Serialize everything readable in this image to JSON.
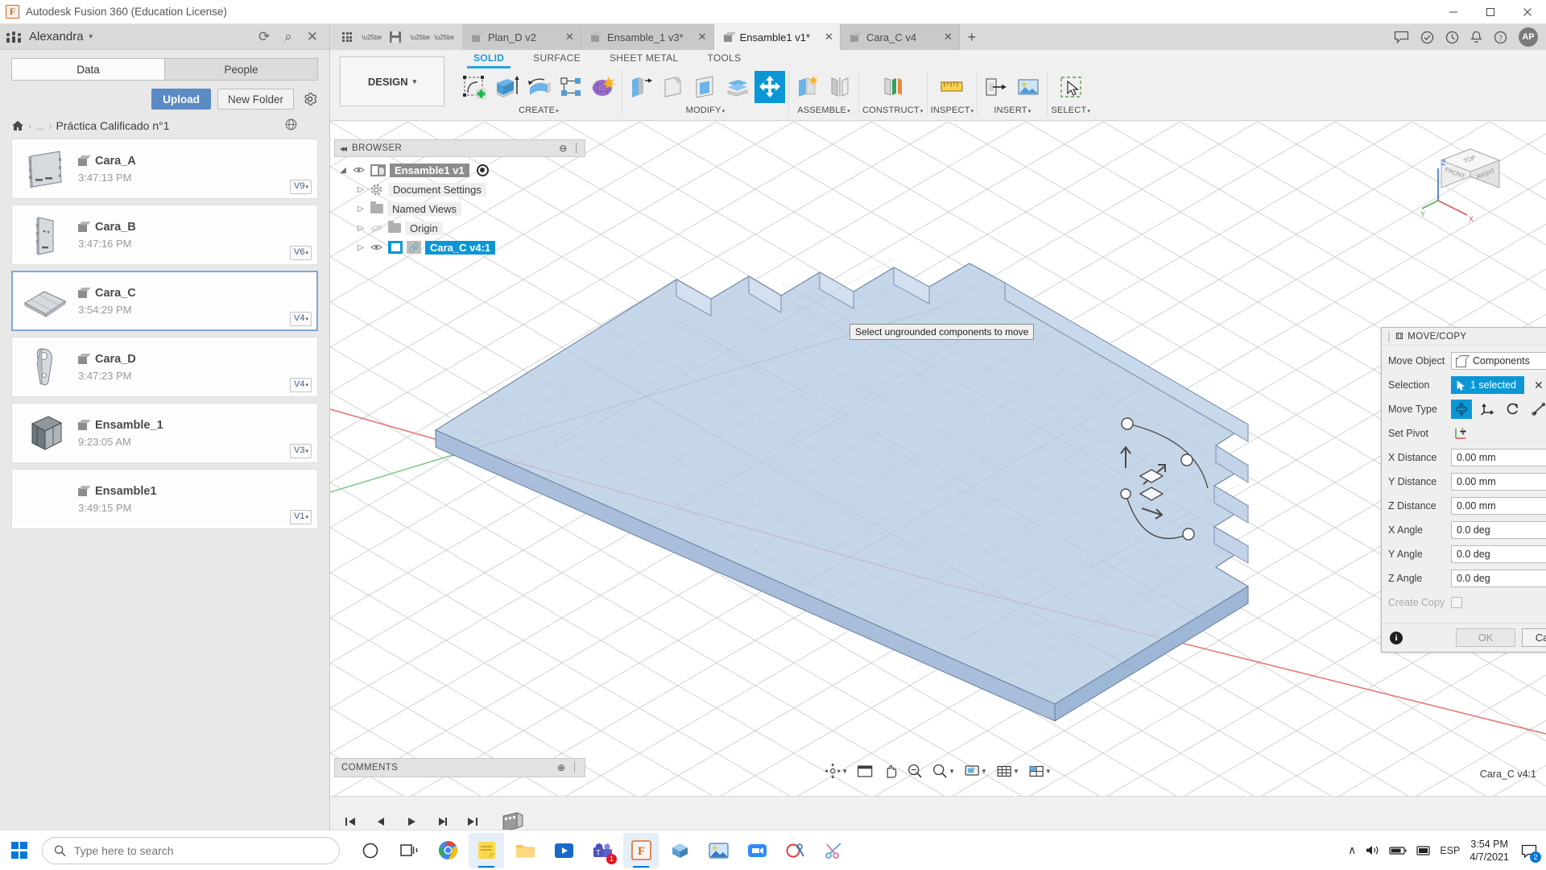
{
  "window": {
    "title": "Autodesk Fusion 360 (Education License)",
    "minimize": "—",
    "maximize": "☐",
    "close": "✕"
  },
  "data_panel": {
    "user": "Alexandra",
    "user_caret": "▾",
    "icons": {
      "refresh": "⟳",
      "search": "⌕",
      "close": "✕"
    },
    "tabs": [
      {
        "label": "Data",
        "active": true
      },
      {
        "label": "People",
        "active": false
      }
    ],
    "upload_label": "Upload",
    "new_folder_label": "New Folder",
    "breadcrumb": {
      "home": "⌂",
      "sep": "›",
      "dots": "...",
      "folder": "Práctica Calificado n°1"
    },
    "items": [
      {
        "name": "Cara_A",
        "time": "3:47:13 PM",
        "version": "V9",
        "selected": false
      },
      {
        "name": "Cara_B",
        "time": "3:47:16 PM",
        "version": "V6",
        "selected": false
      },
      {
        "name": "Cara_C",
        "time": "3:54:29 PM",
        "version": "V4",
        "selected": true
      },
      {
        "name": "Cara_D",
        "time": "3:47:23 PM",
        "version": "V4",
        "selected": false
      },
      {
        "name": "Ensamble_1",
        "time": "9:23:05 AM",
        "version": "V3",
        "selected": false
      },
      {
        "name": "Ensamble1",
        "time": "3:49:15 PM",
        "version": "V1",
        "selected": false
      }
    ],
    "version_caret": "▾"
  },
  "fusion": {
    "quick_access": [
      "grid-icon",
      "new-document-icon",
      "save-icon",
      "undo-icon",
      "redo-icon"
    ],
    "document_tabs": [
      {
        "label": "Plan_D v2",
        "active": false
      },
      {
        "label": "Ensamble_1 v3*",
        "active": false
      },
      {
        "label": "Ensamble1 v1*",
        "active": true
      },
      {
        "label": "Cara_C v4",
        "active": false
      }
    ],
    "new_tab": "+",
    "tab_close": "✕",
    "avatar_initials": "AP",
    "workspace": "DESIGN",
    "workspace_caret": "▾",
    "ribbon_tabs": [
      {
        "label": "SOLID",
        "active": true
      },
      {
        "label": "SURFACE",
        "active": false
      },
      {
        "label": "SHEET METAL",
        "active": false
      },
      {
        "label": "TOOLS",
        "active": false
      }
    ],
    "ribbon_groups": [
      {
        "label": "CREATE",
        "caret": "▾",
        "buttons": [
          "create-sketch-icon",
          "extrude-icon",
          "revolve-icon",
          "pattern-icon",
          "form-icon"
        ]
      },
      {
        "label": "MODIFY",
        "caret": "▾",
        "buttons": [
          "press-pull-icon",
          "fillet-icon",
          "shell-icon",
          "offset-face-icon",
          "move-copy-icon"
        ]
      },
      {
        "label": "ASSEMBLE",
        "caret": "▾",
        "buttons": [
          "new-component-icon",
          "joint-icon"
        ]
      },
      {
        "label": "CONSTRUCT",
        "caret": "▾",
        "buttons": [
          "offset-plane-icon"
        ]
      },
      {
        "label": "INSPECT",
        "caret": "▾",
        "buttons": [
          "measure-icon"
        ]
      },
      {
        "label": "INSERT",
        "caret": "▾",
        "buttons": [
          "derive-icon",
          "insert-mcmaster-icon"
        ]
      },
      {
        "label": "SELECT",
        "caret": "▾",
        "buttons": [
          "select-icon"
        ]
      }
    ],
    "browser": {
      "title": "BROWSER",
      "collapse": "◂◂",
      "minimize_dot": "⊖",
      "nodes": [
        {
          "label": "Ensamble1 v1",
          "style": "root",
          "arrow": "◢",
          "eye": "◉"
        },
        {
          "label": "Document Settings",
          "style": "plain",
          "arrow": "▷",
          "icon": "gear-icon"
        },
        {
          "label": "Named Views",
          "style": "plain",
          "arrow": "▷",
          "icon": "folder-icon"
        },
        {
          "label": "Origin",
          "style": "plain",
          "arrow": "▷",
          "icon": "folder-icon",
          "hidden": true
        },
        {
          "label": "Cara_C v4:1",
          "style": "selected",
          "arrow": "▷",
          "icon": "component-icon"
        }
      ]
    },
    "tooltip": "Select ungrounded components to move",
    "move_copy": {
      "title": "MOVE/COPY",
      "expand": "▸▸",
      "rows": [
        {
          "label": "Move Object",
          "type": "select",
          "value": "Components"
        },
        {
          "label": "Selection",
          "type": "selection",
          "value": "1 selected"
        },
        {
          "label": "Move Type",
          "type": "movetype"
        },
        {
          "label": "Set Pivot",
          "type": "pivot"
        },
        {
          "label": "X Distance",
          "type": "input",
          "value": "0.00 mm"
        },
        {
          "label": "Y Distance",
          "type": "input",
          "value": "0.00 mm"
        },
        {
          "label": "Z Distance",
          "type": "input",
          "value": "0.00 mm"
        },
        {
          "label": "X Angle",
          "type": "input",
          "value": "0.0 deg"
        },
        {
          "label": "Y Angle",
          "type": "input",
          "value": "0.0 deg"
        },
        {
          "label": "Z Angle",
          "type": "input",
          "value": "0.0 deg"
        },
        {
          "label": "Create Copy",
          "type": "checkbox",
          "disabled": true
        }
      ],
      "ok_label": "OK",
      "cancel_label": "Cancel",
      "info": "i",
      "clear_selection": "✕"
    },
    "view_cube": {
      "top": "TOP",
      "front": "FRONT",
      "right": "RIGHT",
      "axis_z": "Z",
      "axis_x": "X",
      "axis_y": "Y"
    },
    "comments": {
      "title": "COMMENTS",
      "dot": "⊕"
    },
    "status_corner": "Cara_C v4:1",
    "nav_bar": [
      "orbit-icon",
      "pan-window-icon",
      "pan-icon",
      "zoom-icon",
      "zoom-window-icon",
      "display-settings-icon",
      "grid-snap-icon",
      "viewports-icon"
    ],
    "timeline": [
      "skip-start-icon",
      "step-back-icon",
      "play-icon",
      "step-forward-icon",
      "skip-end-icon",
      "timeline-marker-icon"
    ]
  },
  "taskbar": {
    "search_placeholder": "Type here to search",
    "apps": [
      {
        "name": "cortana-icon",
        "badge": ""
      },
      {
        "name": "task-view-icon",
        "badge": ""
      },
      {
        "name": "chrome-icon",
        "badge": ""
      },
      {
        "name": "sticky-notes-icon",
        "badge": ""
      },
      {
        "name": "file-explorer-icon",
        "badge": ""
      },
      {
        "name": "media-player-icon",
        "badge": ""
      },
      {
        "name": "microsoft-teams-icon",
        "badge": "1"
      },
      {
        "name": "fusion-360-icon",
        "badge": ""
      },
      {
        "name": "inventor-icon",
        "badge": ""
      },
      {
        "name": "photos-icon",
        "badge": ""
      },
      {
        "name": "zoom-icon",
        "badge": ""
      },
      {
        "name": "autocad-icon",
        "badge": ""
      },
      {
        "name": "scissors-icon",
        "badge": ""
      }
    ],
    "tray": {
      "chevron": "∧",
      "volume": "🔊",
      "battery": "▬",
      "network": "▣",
      "language": "ESP"
    },
    "clock": {
      "time": "3:54 PM",
      "date": "4/7/2021"
    },
    "notification_count": "2"
  }
}
